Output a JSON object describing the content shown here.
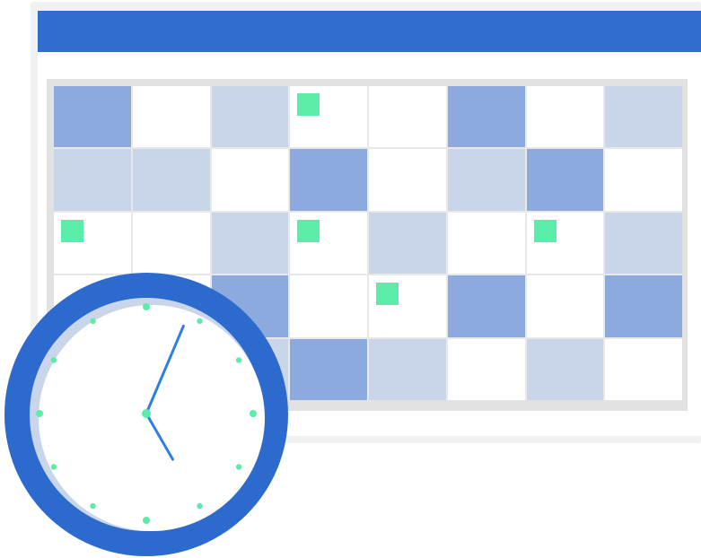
{
  "colors": {
    "header": "#2f6dcf",
    "frame": "#f1f1f1",
    "cell_light": "#c9d6ea",
    "cell_dark": "#8daade",
    "marker": "#5cecaa",
    "clock_ring": "#2c6bcd",
    "clock_face": "#ffffff",
    "clock_shadow": "#c9d6ea",
    "hands": "#2d7fe5",
    "tick_dots": "#5cecaa"
  },
  "calendar": {
    "columns": 8,
    "rows": 5,
    "cell_shades": [
      [
        2,
        0,
        1,
        0,
        0,
        2,
        0,
        1
      ],
      [
        1,
        1,
        0,
        2,
        0,
        1,
        2,
        0
      ],
      [
        0,
        0,
        1,
        0,
        1,
        0,
        0,
        1
      ],
      [
        0,
        0,
        2,
        0,
        0,
        2,
        0,
        2
      ],
      [
        0,
        0,
        1,
        2,
        1,
        0,
        1,
        0
      ]
    ],
    "markers": [
      [
        0,
        3
      ],
      [
        2,
        0
      ],
      [
        2,
        3
      ],
      [
        2,
        6
      ],
      [
        3,
        4
      ]
    ]
  },
  "clock": {
    "icon": "clock-icon",
    "hour_hand_angle_deg": 150,
    "minute_hand_angle_deg": 23,
    "tick_count": 12
  }
}
